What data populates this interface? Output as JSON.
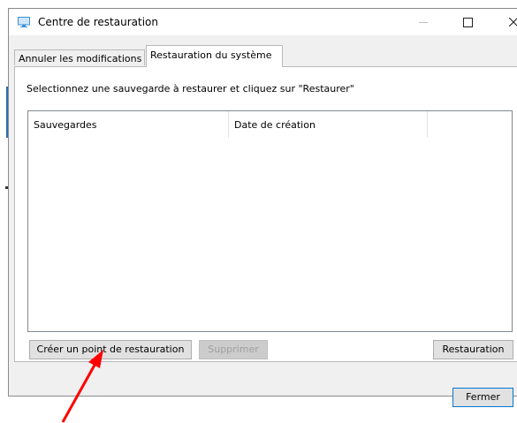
{
  "window": {
    "title": "Centre de restauration",
    "controls": {
      "minimize": "minimize-icon",
      "maximize": "maximize-icon",
      "close": "close-icon"
    }
  },
  "tabs": [
    {
      "label": "Annuler les modifications",
      "active": false
    },
    {
      "label": "Restauration du système",
      "active": true
    }
  ],
  "panel": {
    "instruction": "Selectionnez une sauvegarde à restaurer et cliquez sur \"Restaurer\"",
    "list": {
      "columns": [
        "Sauvegardes",
        "Date de création",
        ""
      ],
      "rows": []
    }
  },
  "buttons": {
    "create": "Créer un point de restauration",
    "delete": "Supprimer",
    "restore": "Restauration",
    "close": "Fermer"
  },
  "annotation": {
    "arrow_color": "#ff0000",
    "points_to": "create-restore-point-button"
  },
  "colors": {
    "accent": "#0078d7",
    "title_icon": "#3d8fd6"
  }
}
